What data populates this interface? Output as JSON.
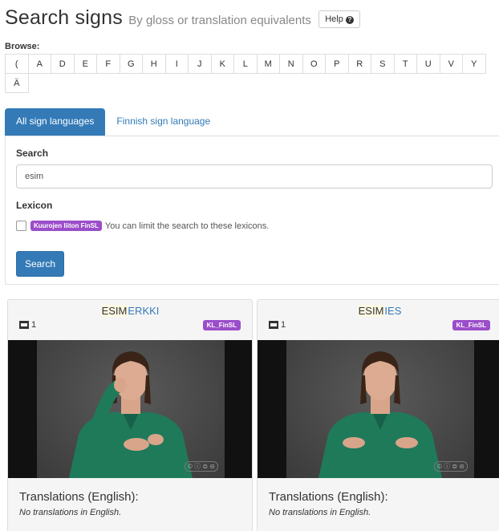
{
  "header": {
    "title": "Search signs",
    "subtitle": "By gloss or translation equivalents",
    "help_label": "Help"
  },
  "browse": {
    "label": "Browse:",
    "letters_row1": [
      "(",
      "A",
      "D",
      "E",
      "F",
      "G",
      "H",
      "I",
      "J",
      "K",
      "L",
      "M",
      "N",
      "O",
      "P",
      "R",
      "S",
      "T",
      "U",
      "V",
      "Y"
    ],
    "letters_row2": [
      "Ä"
    ]
  },
  "tabs": [
    {
      "label": "All sign languages",
      "active": true
    },
    {
      "label": "Finnish sign language",
      "active": false
    }
  ],
  "search": {
    "label": "Search",
    "value": "esim",
    "lexicon_label": "Lexicon",
    "lexicon_badge": "Kuurojen liiton FinSL",
    "lexicon_hint": "You can limit the search to these lexicons.",
    "lexicon_checked": false,
    "button_label": "Search"
  },
  "results": [
    {
      "gloss_match": "ESIM",
      "gloss_rest": "ERKKI",
      "video_count": "1",
      "lexicon_badge": "KL_FinSL",
      "translations_title": "Translations (English):",
      "translations_text": "No translations in English."
    },
    {
      "gloss_match": "ESIM",
      "gloss_rest": "IES",
      "video_count": "1",
      "lexicon_badge": "KL_FinSL",
      "translations_title": "Translations (English):",
      "translations_text": "No translations in English."
    }
  ],
  "colors": {
    "accent": "#337ab7",
    "badge": "#9b4dca",
    "shirt": "#1f7a5a",
    "highlight": "#fcf8e3"
  }
}
